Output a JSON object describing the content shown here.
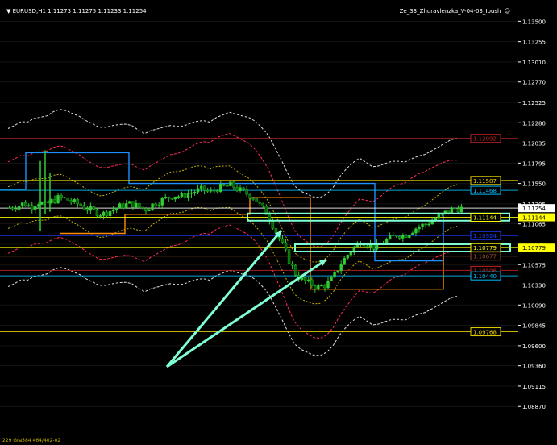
{
  "header": {
    "symbol_line": "▼ EURUSD,H1  1.11273 1.11275 1.11233 1.11254",
    "indicator_name": "Ze_33_Zhuravlenzka_V-04-03_Ibush",
    "smiley": "☺"
  },
  "footer_text": "229 Gra584 464/402-02",
  "price_scale": {
    "min": 1.0863,
    "max": 1.1361,
    "ticks": [
      "1.13500",
      "1.13255",
      "1.13010",
      "1.12770",
      "1.12525",
      "1.12280",
      "1.12035",
      "1.11795",
      "1.11550",
      "1.11305",
      "1.11065",
      "1.10820",
      "1.10575",
      "1.10330",
      "1.10090",
      "1.09845",
      "1.09600",
      "1.09360",
      "1.09115",
      "1.08870"
    ]
  },
  "levels": [
    {
      "name": "level-1.12092",
      "price": 1.12092,
      "label": "1.12092",
      "color": "#b22222"
    },
    {
      "name": "level-1.11587",
      "price": 1.11587,
      "label": "1.11587",
      "color": "#e6d200"
    },
    {
      "name": "level-1.11468",
      "price": 1.11468,
      "label": "1.11468",
      "color": "#00bfff"
    },
    {
      "name": "level-1.11254",
      "price": 1.11254,
      "label": "1.11254",
      "color": "#ffffff",
      "current": true
    },
    {
      "name": "level-1.11144",
      "price": 1.11144,
      "label": "1.11144",
      "color": "#ffff00"
    },
    {
      "name": "level-1.10924",
      "price": 1.10924,
      "label": "1.10924",
      "color": "#1e3cff"
    },
    {
      "name": "level-1.10779",
      "price": 1.10779,
      "label": "1.10779",
      "color": "#ffff00"
    },
    {
      "name": "level-1.10677",
      "price": 1.10677,
      "label": "1.10677",
      "color": "#a0522d"
    },
    {
      "name": "level-1.10506",
      "price": 1.10506,
      "label": "1.10506",
      "color": "#cc2222"
    },
    {
      "name": "level-1.10440",
      "price": 1.1044,
      "label": "1.10440",
      "color": "#00bfff"
    },
    {
      "name": "level-1.09768",
      "price": 1.09768,
      "label": "1.09768",
      "color": "#e6d200"
    }
  ],
  "colors": {
    "background": "#000000",
    "bull_candle": "#32cd32",
    "bear_candle": "#006400",
    "grid": "#ffffff",
    "arrow": "#7fffd4",
    "zone_box": "#7fffd4",
    "envelope_orange": "#ff8c00",
    "envelope_blue": "#1e90ff",
    "bands_red": "#ff2d55",
    "bands_white": "#dddddd",
    "bands_yellow": "#c8b400"
  },
  "chart_data": {
    "type": "candlestick",
    "symbol": "EURUSD",
    "timeframe": "H1",
    "ohlc_last": {
      "open": 1.11273,
      "high": 1.11275,
      "low": 1.11233,
      "close": 1.11254
    },
    "ylim": [
      1.0863,
      1.1361
    ],
    "close_path": [
      1.1126,
      1.1128,
      1.1131,
      1.1127,
      1.1133,
      1.1129,
      1.1134,
      1.1138,
      1.1136,
      1.1132,
      1.1129,
      1.1124,
      1.1121,
      1.1118,
      1.1122,
      1.1126,
      1.1129,
      1.1131,
      1.1127,
      1.1124,
      1.113,
      1.1134,
      1.1138,
      1.1141,
      1.1139,
      1.1143,
      1.1146,
      1.1148,
      1.1144,
      1.1149,
      1.1151,
      1.1153,
      1.1147,
      1.1143,
      1.1139,
      1.1128,
      1.1118,
      1.11,
      1.1082,
      1.1062,
      1.1045,
      1.1038,
      1.1034,
      1.103,
      1.1033,
      1.104,
      1.1056,
      1.1068,
      1.1078,
      1.1086,
      1.1082,
      1.1078,
      1.1084,
      1.1089,
      1.1094,
      1.1092,
      1.1098,
      1.1103,
      1.1106,
      1.1111,
      1.1116,
      1.1121,
      1.1125,
      1.1125
    ]
  }
}
